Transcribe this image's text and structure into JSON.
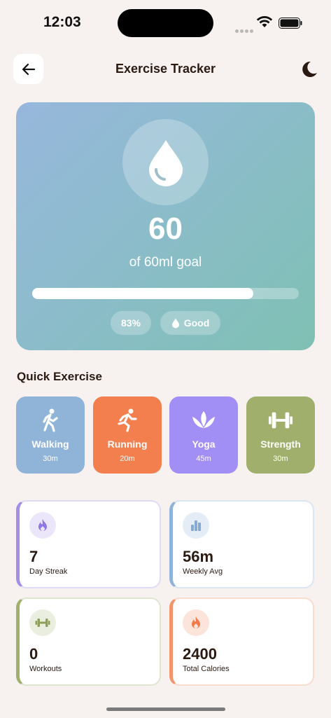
{
  "status_bar": {
    "time": "12:03"
  },
  "header": {
    "title": "Exercise Tracker"
  },
  "hero": {
    "value": "60",
    "goal_text": "of 60ml goal",
    "progress_fraction": 0.83,
    "percent_label": "83%",
    "status_label": "Good"
  },
  "quick_exercise": {
    "title": "Quick Exercise",
    "items": [
      {
        "label": "Walking",
        "duration": "30m",
        "color": "#8fb4d8",
        "icon": "walking-icon"
      },
      {
        "label": "Running",
        "duration": "20m",
        "color": "#f47f4e",
        "icon": "running-icon"
      },
      {
        "label": "Yoga",
        "duration": "45m",
        "color": "#a28ff5",
        "icon": "lotus-icon"
      },
      {
        "label": "Strength",
        "duration": "30m",
        "color": "#a0b06c",
        "icon": "dumbbell-icon"
      }
    ]
  },
  "stats": [
    {
      "value": "7",
      "label": "Day Streak",
      "accent": "#a48fe8",
      "icon": "flame-icon"
    },
    {
      "value": "56m",
      "label": "Weekly Avg",
      "accent": "#8fb4d8",
      "icon": "bar-chart-icon"
    },
    {
      "value": "0",
      "label": "Workouts",
      "accent": "#a0b06c",
      "icon": "dumbbell-icon"
    },
    {
      "value": "2400",
      "label": "Total Calories",
      "accent": "#f4946a",
      "icon": "flame-icon"
    }
  ]
}
